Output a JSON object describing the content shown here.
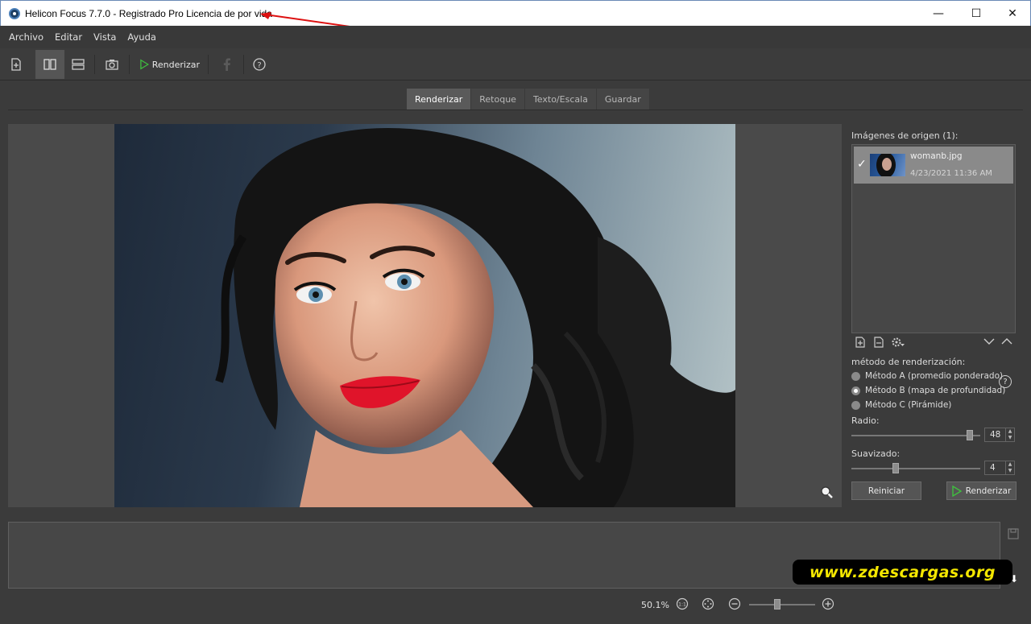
{
  "window": {
    "title": "Helicon Focus 7.7.0 - Registrado Pro Licencia de por vida",
    "minimize": "—",
    "maximize": "☐",
    "close": "✕"
  },
  "menu": [
    "Archivo",
    "Editar",
    "Vista",
    "Ayuda"
  ],
  "toolbar": {
    "render_label": "Renderizar",
    "icons": [
      "add-file-icon",
      "split-vertical-icon",
      "split-horizontal-icon",
      "camera-icon",
      "play-icon",
      "facebook-icon",
      "help-icon"
    ]
  },
  "tabs": [
    {
      "label": "Renderizar",
      "active": true
    },
    {
      "label": "Retoque",
      "active": false
    },
    {
      "label": "Texto/Escala",
      "active": false
    },
    {
      "label": "Guardar",
      "active": false
    }
  ],
  "sources": {
    "title": "Imágenes de origen (1):",
    "items": [
      {
        "name": "womanb.jpg",
        "date": "4/23/2021 11:36 AM",
        "checked": true
      }
    ]
  },
  "method": {
    "title": "método de renderización:",
    "options": [
      {
        "label": "Método A (promedio ponderado)",
        "selected": false
      },
      {
        "label": "Método B (mapa de profundidad)",
        "selected": true
      },
      {
        "label": "Método C (Pirámide)",
        "selected": false
      }
    ],
    "help": "?"
  },
  "radius": {
    "label": "Radio:",
    "value": "48"
  },
  "smoothing": {
    "label": "Suavizado:",
    "value": "4"
  },
  "buttons": {
    "reset": "Reiniciar",
    "render": "Renderizar"
  },
  "watermark": "www.zdescargas.org",
  "status": {
    "zoom": "50.1%"
  },
  "colors": {
    "accent_green": "#3fbf3f",
    "background": "#3b3b3b",
    "watermark_text": "#f3e600"
  }
}
